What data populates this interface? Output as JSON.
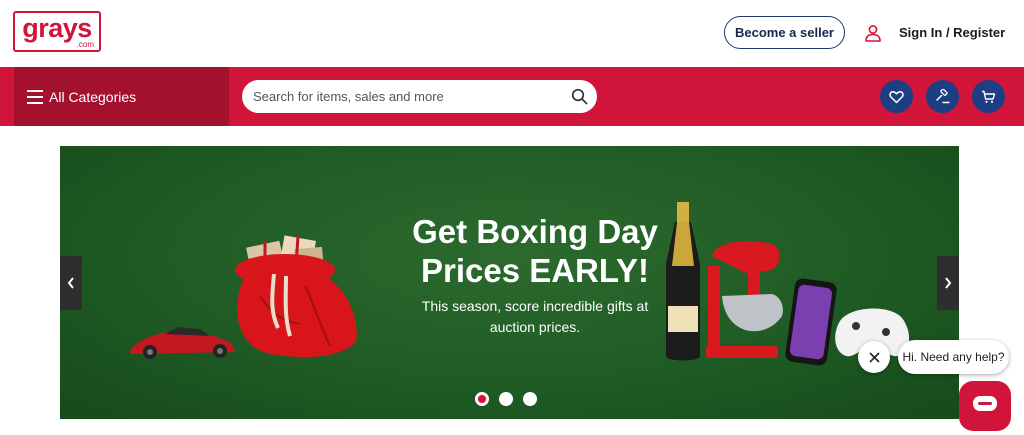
{
  "header": {
    "logo_text": "grays",
    "logo_sub": ".com",
    "become_seller_label": "Become a seller",
    "signin_label": "Sign In / Register"
  },
  "nav": {
    "all_categories_label": "All Categories",
    "search_placeholder": "Search for items, sales and more",
    "icons": [
      "heart-icon",
      "gavel-icon",
      "cart-icon"
    ]
  },
  "banner": {
    "headline_line1": "Get Boxing Day",
    "headline_line2": "Prices EARLY!",
    "subline_line1": "This season, score incredible gifts at",
    "subline_line2": "auction prices.",
    "slide_count": 3,
    "active_slide": 1
  },
  "chat": {
    "prompt": "Hi. Need any help?"
  },
  "colors": {
    "brand_red": "#d0143a",
    "dark_red": "#a3112f",
    "navy": "#1d3e80",
    "banner_green": "#1f5b24"
  }
}
